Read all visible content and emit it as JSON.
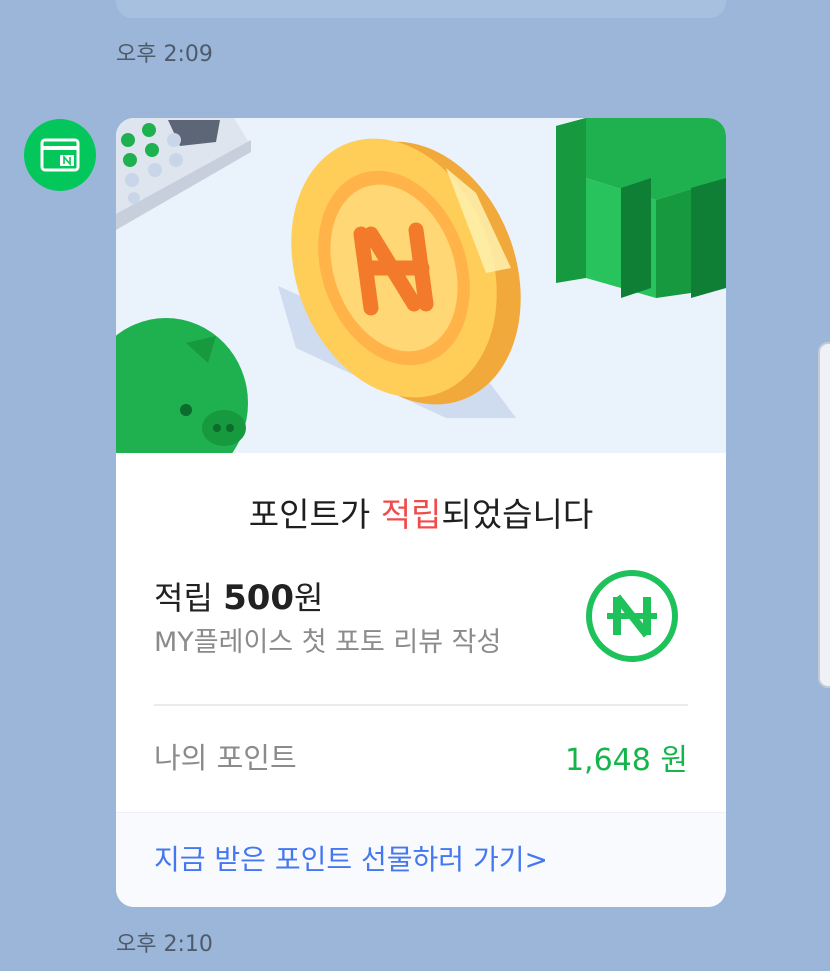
{
  "chat": {
    "time_top": "오후 2:09",
    "time_bottom": "오후 2:10"
  },
  "card": {
    "title_prefix": "포인트가 ",
    "title_highlight": "적립",
    "title_suffix": "되었습니다",
    "earn_label": "적립 ",
    "earn_amount": "500",
    "earn_unit": "원",
    "earn_reason": "MY플레이스 첫 포토 리뷰 작성",
    "my_points_label": "나의 포인트",
    "my_points_value": "1,648 원",
    "gift_link": "지금 받은 포인트 선물하러 가기>"
  },
  "colors": {
    "background": "#9bb6d9",
    "brand_green": "#03c75a",
    "points_green": "#16b54c",
    "highlight_red": "#f04c4c",
    "link_blue": "#4478f0"
  },
  "icons": {
    "avatar": "naver-pay-card-icon",
    "badge": "naver-pay-coin-icon"
  }
}
